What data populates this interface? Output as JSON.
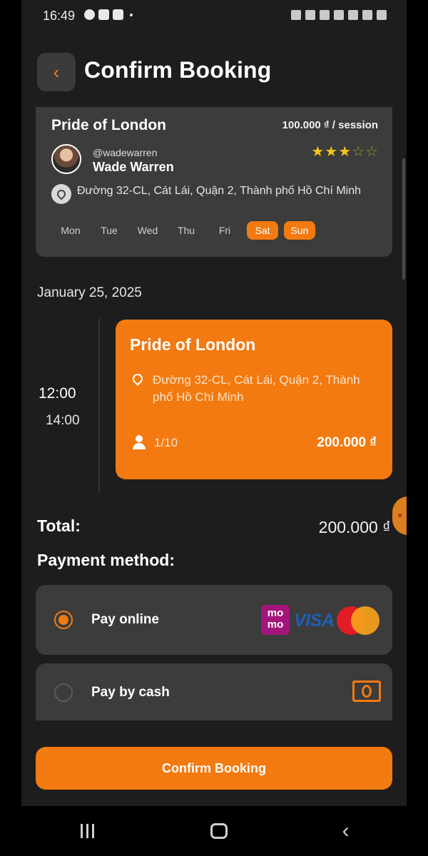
{
  "status_bar": {
    "time": "16:49"
  },
  "header": {
    "title": "Confirm Booking",
    "back_icon": "chevron-left-icon"
  },
  "pitch": {
    "name": "Pride of London",
    "price": "100.000 ₫ / session",
    "owner_handle": "@wadewarren",
    "owner_name": "Wade Warren",
    "rating": 3,
    "rating_max": 5,
    "address": "Đường 32-CL, Cát Lái, Quận 2, Thành phố Hồ Chí Minh",
    "days": [
      {
        "label": "Mon",
        "active": false
      },
      {
        "label": "Tue",
        "active": false
      },
      {
        "label": "Wed",
        "active": false
      },
      {
        "label": "Thu",
        "active": false
      },
      {
        "label": "Fri",
        "active": false
      },
      {
        "label": "Sat",
        "active": true
      },
      {
        "label": "Sun",
        "active": true
      }
    ]
  },
  "booking": {
    "date": "January 25, 2025",
    "time_start": "12:00",
    "time_end": "14:00",
    "title": "Pride of London",
    "address": "Đường 32-CL, Cát Lái, Quận 2, Thành phố Hồ Chí Minh",
    "slots": "1/10",
    "price": "200.000 ₫"
  },
  "summary": {
    "total_label": "Total:",
    "total_value": "200.000 ₫",
    "payment_title": "Payment method:"
  },
  "payment_options": {
    "online_label": "Pay online",
    "cash_label": "Pay by cash",
    "selected": "online",
    "momo_text": "mo mo",
    "visa_text": "VISA"
  },
  "confirm_button": {
    "label": "Confirm Booking"
  },
  "colors": {
    "accent": "#f27a10",
    "background": "#1c1d1c",
    "card": "#3b3c3b"
  }
}
